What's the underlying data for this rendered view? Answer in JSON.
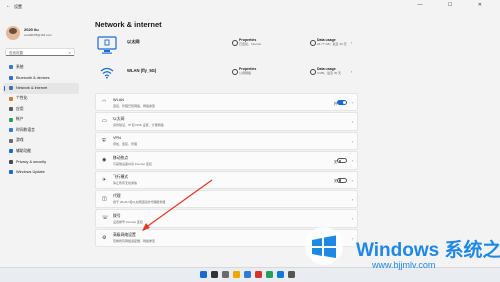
{
  "window": {
    "title": "设置",
    "controls": "— ☐ ✕"
  },
  "user": {
    "name": "2020 liu",
    "email": "cedd4678@163.com"
  },
  "search": {
    "placeholder": "查找设置"
  },
  "nav": [
    {
      "label": "系统",
      "color": "#2e7cd6"
    },
    {
      "label": "Bluetooth & devices",
      "color": "#2f6fd0"
    },
    {
      "label": "Network & internet",
      "color": "#4a6fa5",
      "active": true
    },
    {
      "label": "个性化",
      "color": "#d47a2a"
    },
    {
      "label": "应用",
      "color": "#5a5a5a"
    },
    {
      "label": "帐户",
      "color": "#2aa05a"
    },
    {
      "label": "时间和语言",
      "color": "#2e7cd6"
    },
    {
      "label": "游戏",
      "color": "#6b6b6b"
    },
    {
      "label": "辅助功能",
      "color": "#1a6bd0"
    },
    {
      "label": "Privacy & security",
      "color": "#4a4a4a"
    },
    {
      "label": "Windows Update",
      "color": "#1a6bd0"
    }
  ],
  "page": {
    "title": "Network & internet"
  },
  "connections": [
    {
      "name": "以太网",
      "sub": "",
      "prop_title": "Properties",
      "prop_sub": "已连接，Internet",
      "usage_title": "Data usage",
      "usage_sub": "24.77 GB，最近 30 天"
    },
    {
      "name": "WLAN (fly_5G)",
      "sub": "",
      "prop_title": "Properties",
      "prop_sub": "公用网络",
      "usage_title": "Data usage",
      "usage_sub": "0 MB，最近 30 天"
    }
  ],
  "rows": [
    {
      "icon": "wifi-icon",
      "glyph": "◠",
      "label": "WLAN",
      "sub": "连接，管理已知网络，网络类型",
      "state": "开",
      "toggle": "on"
    },
    {
      "icon": "ethernet-icon",
      "glyph": "▭",
      "label": "以太网",
      "sub": "身份验证，IP 和 DNS 设置，计量网络",
      "state": "",
      "toggle": ""
    },
    {
      "icon": "vpn-icon",
      "glyph": "⛨",
      "label": "VPN",
      "sub": "添加，连接，管理",
      "state": "",
      "toggle": ""
    },
    {
      "icon": "hotspot-icon",
      "glyph": "◉",
      "label": "移动热点",
      "sub": "与其他设备共享 Internet 连接",
      "state": "关",
      "toggle": "off"
    },
    {
      "icon": "airplane-icon",
      "glyph": "✈",
      "label": "飞行模式",
      "sub": "停止所有无线通信",
      "state": "关",
      "toggle": "off"
    },
    {
      "icon": "proxy-icon",
      "glyph": "◫",
      "label": "代理",
      "sub": "用于 WLAN 和以太网连接的代理服务器",
      "state": "",
      "toggle": ""
    },
    {
      "icon": "dialup-icon",
      "glyph": "☏",
      "label": "拨号",
      "sub": "设置拨号 Internet 连接",
      "state": "",
      "toggle": ""
    },
    {
      "icon": "advanced-network-icon",
      "glyph": "⚙",
      "label": "高级网络设置",
      "sub": "查看所有网络适配器，网络重置",
      "state": "",
      "toggle": ""
    }
  ],
  "taskbar": {
    "icons": [
      "#1a6bd0",
      "#333333",
      "#6b6b6b",
      "#f0a500",
      "#2e7cd6",
      "#d9342b",
      "#2a9d5a",
      "#0f7bd8",
      "#555555"
    ]
  },
  "watermark": {
    "brand": "Windows 系统之家",
    "url": "www.bjjmlv.com"
  }
}
